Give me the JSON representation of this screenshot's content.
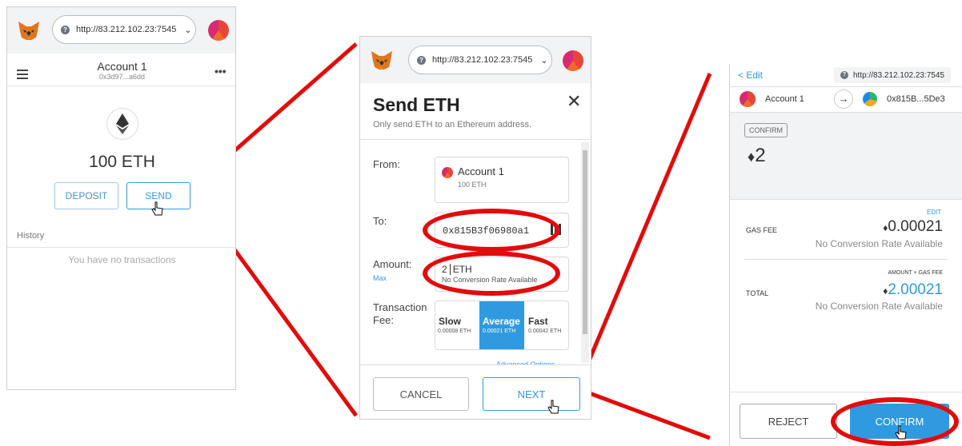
{
  "url": "http://83.212.102.23:7545",
  "panel1": {
    "account_name": "Account 1",
    "account_address": "0x3d97...a6dd",
    "balance": "100 ETH",
    "deposit_label": "DEPOSIT",
    "send_label": "SEND",
    "history_label": "History",
    "empty_history": "You have no transactions"
  },
  "panel2": {
    "title": "Send ETH",
    "subtitle": "Only send ETH to an Ethereum address.",
    "from_label": "From:",
    "from_account": "Account 1",
    "from_balance": "100 ETH",
    "to_label": "To:",
    "to_value": "0x815B3f06980a1",
    "amount_label": "Amount:",
    "max_label": "Max",
    "amount_value": "2",
    "amount_unit": "ETH",
    "conversion_note": "No Conversion Rate Available",
    "fee_label_1": "Transaction",
    "fee_label_2": "Fee:",
    "fees": [
      {
        "label": "Slow",
        "value": "0.00008 ETH"
      },
      {
        "label": "Average",
        "value": "0.00021 ETH"
      },
      {
        "label": "Fast",
        "value": "0.00042 ETH"
      }
    ],
    "advanced_options": "Advanced Options",
    "cancel_label": "CANCEL",
    "next_label": "NEXT"
  },
  "panel3": {
    "edit_label": "< Edit",
    "from_account": "Account 1",
    "to_address": "0x815B...5De3",
    "confirm_badge": "CONFIRM",
    "amount": "2",
    "edit_link": "EDIT",
    "gas_fee_label": "GAS FEE",
    "gas_fee_value": "0.00021",
    "no_conversion_1": "No Conversion Rate Available",
    "amount_gas_label": "AMOUNT + GAS FEE",
    "total_label": "TOTAL",
    "total_value": "2.00021",
    "no_conversion_2": "No Conversion Rate Available",
    "reject_label": "REJECT",
    "confirm_label": "CONFIRM"
  },
  "colors": {
    "accent": "#2f9ae0",
    "annotation": "#e30b0b",
    "selected_fee": "#2f9ae0"
  }
}
